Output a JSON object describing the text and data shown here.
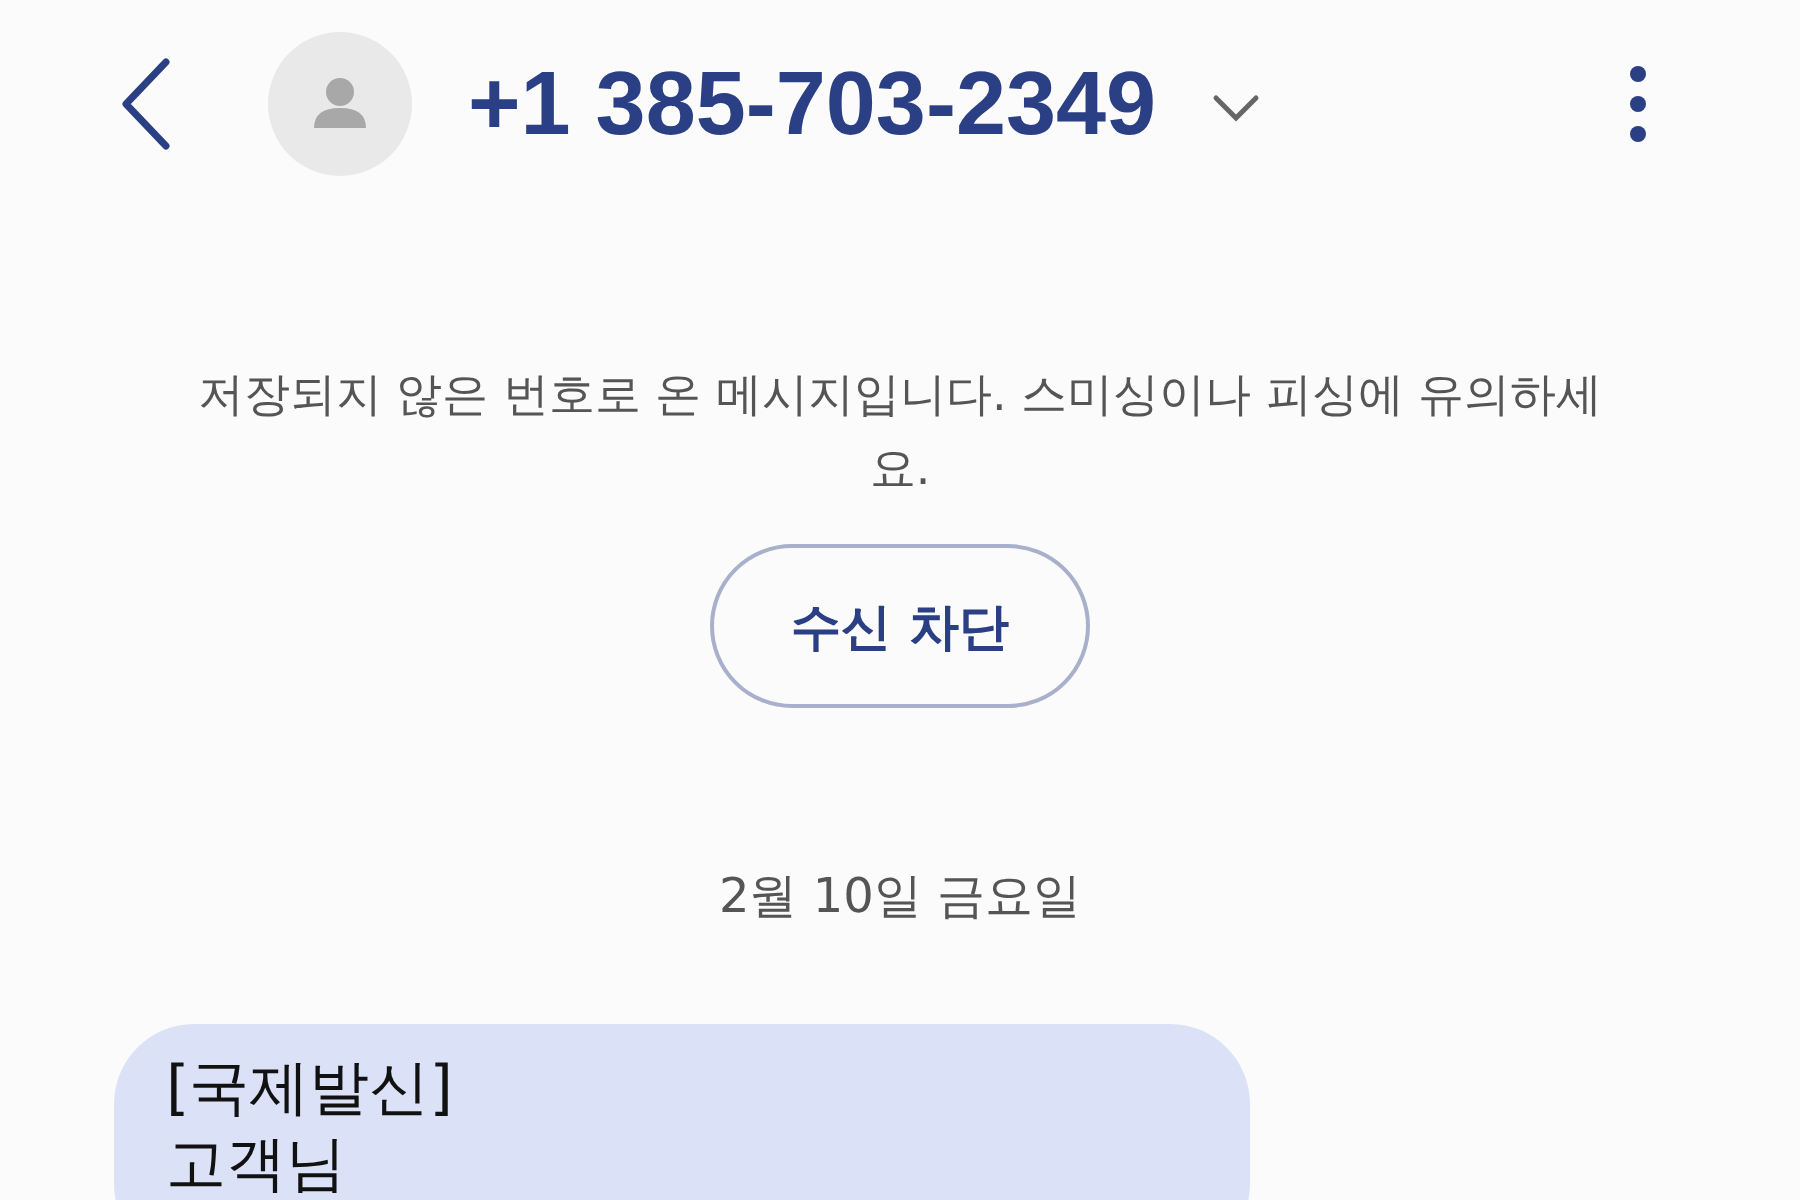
{
  "header": {
    "contact": "+1 385-703-2349"
  },
  "notice": {
    "text": "저장되지 않은 번호로 온 메시지입니다. 스미싱이나 피싱에 유의하세요.",
    "button": "수신 차단"
  },
  "date_divider": "2월 10일 금요일",
  "messages": [
    {
      "lines": [
        "[국제발신]",
        "고객님"
      ]
    }
  ]
}
